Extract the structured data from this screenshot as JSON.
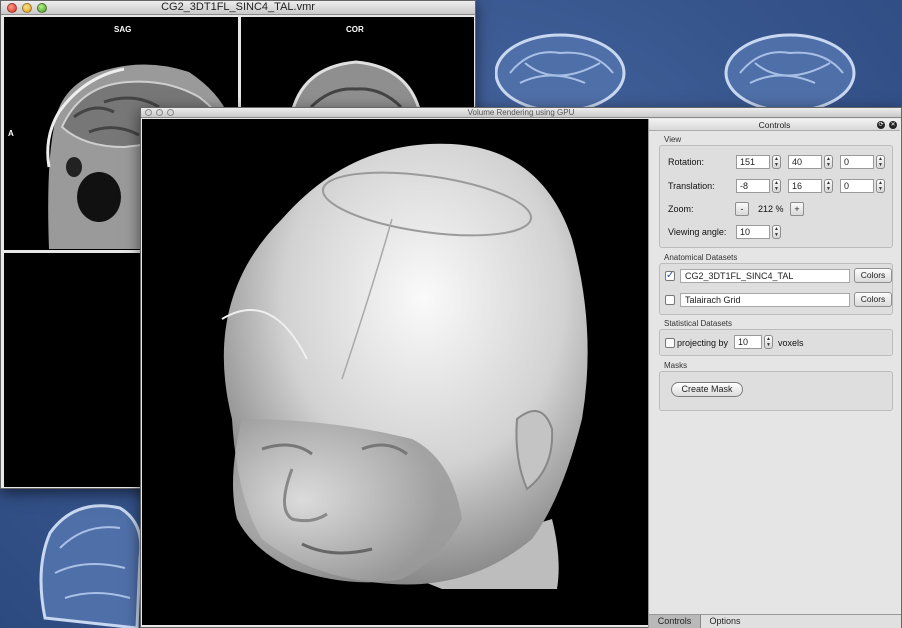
{
  "window_back": {
    "title": "CG2_3DT1FL_SINC4_TAL.vmr",
    "panes": {
      "sag_label": "SAG",
      "cor_label": "COR",
      "left_marker": "A"
    }
  },
  "window_front": {
    "title": "Volume Rendering using GPU"
  },
  "controls": {
    "title": "Controls",
    "view": {
      "section_title": "View",
      "rotation_label": "Rotation:",
      "rotation_values": [
        "151",
        "40",
        "0"
      ],
      "translation_label": "Translation:",
      "translation_values": [
        "-8",
        "16",
        "0"
      ],
      "zoom_label": "Zoom:",
      "zoom_minus": "-",
      "zoom_value": "212 %",
      "zoom_plus": "+",
      "viewing_angle_label": "Viewing angle:",
      "viewing_angle_value": "10"
    },
    "anatomical": {
      "section_title": "Anatomical Datasets",
      "datasets": [
        {
          "name": "CG2_3DT1FL_SINC4_TAL",
          "checked": true,
          "button": "Colors"
        },
        {
          "name": "Talairach Grid",
          "checked": false,
          "button": "Colors"
        }
      ]
    },
    "statistical": {
      "section_title": "Statistical Datasets",
      "projecting_label": "projecting by",
      "projecting_value": "10",
      "voxels_label": "voxels"
    },
    "masks": {
      "section_title": "Masks",
      "create_mask_label": "Create Mask"
    },
    "tabs": [
      "Controls",
      "Options"
    ]
  },
  "colors": {
    "desktop": "#3c5a93",
    "checkbox_accent": "#2a4fa0"
  }
}
